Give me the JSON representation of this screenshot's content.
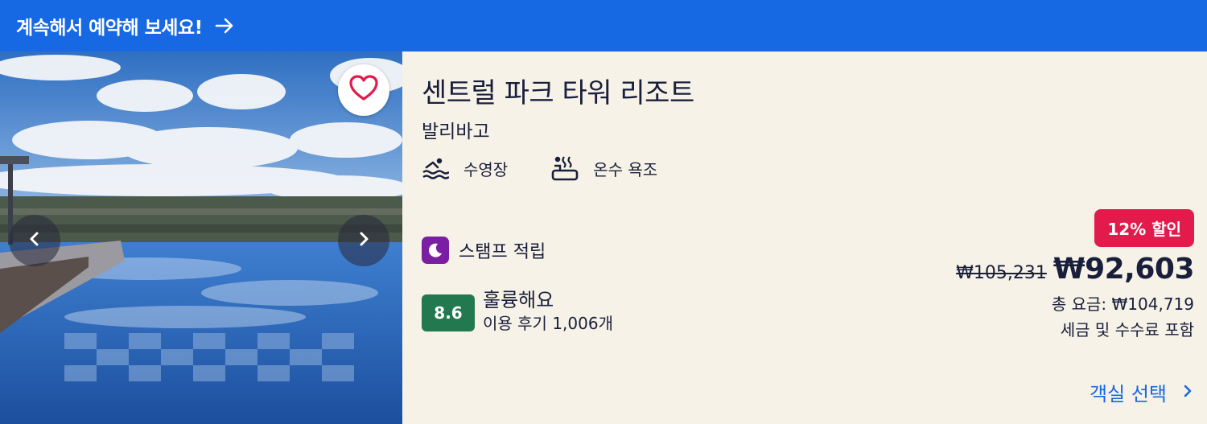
{
  "banner": {
    "text": "계속해서 예약해 보세요!",
    "arrow_icon": "arrow-right-icon"
  },
  "photo": {
    "favorite_icon": "heart-icon",
    "prev_icon": "chevron-left-icon",
    "next_icon": "chevron-right-icon"
  },
  "hotel": {
    "name": "센트럴 파크 타워 리조트",
    "location": "발리바고"
  },
  "amenities": [
    {
      "icon": "pool-icon",
      "label": "수영장"
    },
    {
      "icon": "hot-tub-icon",
      "label": "온수 욕조"
    }
  ],
  "stamp": {
    "icon": "moon-icon",
    "label": "스탬프 적립"
  },
  "rating": {
    "score": "8.6",
    "word": "훌륭해요",
    "reviews": "이용 후기 1,006개"
  },
  "pricing": {
    "discount": "12% 할인",
    "old_price": "₩105,231",
    "new_price": "₩92,603",
    "total": "총 요금: ₩104,719",
    "tax_note": "세금 및 수수료 포함"
  },
  "cta": {
    "label": "객실 선택",
    "icon": "chevron-right-icon"
  },
  "colors": {
    "banner": "#1668e3",
    "card_bg": "#f6f2e7",
    "discount": "#e31b4d",
    "score": "#227950",
    "stamp": "#7b1fa2",
    "link": "#1668e3"
  }
}
